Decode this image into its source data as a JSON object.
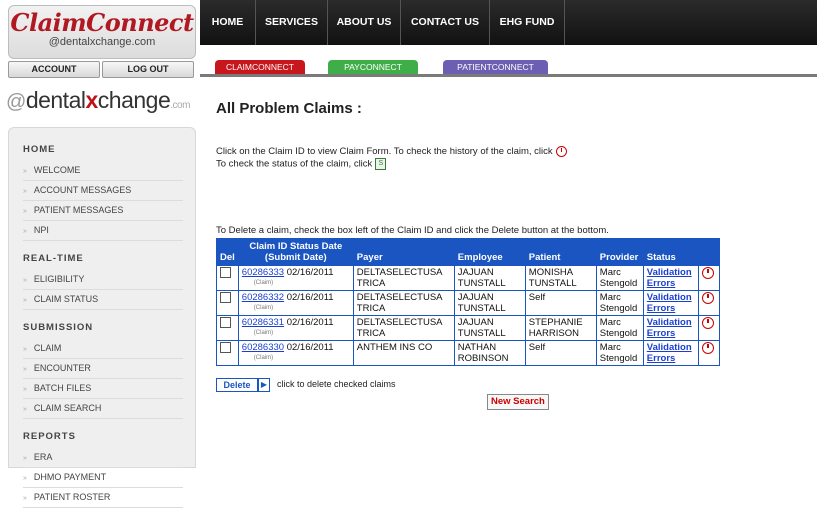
{
  "logo": {
    "title": "ClaimConnect",
    "sub": "@dentalxchange.com"
  },
  "account_bar": {
    "account_label": "ACCOUNT",
    "logout_label": "LOG OUT"
  },
  "brand": {
    "at": "@",
    "dental": "dental",
    "x": "x",
    "change": "change",
    "com": ".com"
  },
  "sidebar": {
    "sections": [
      {
        "title": "HOME",
        "items": [
          "WELCOME",
          "ACCOUNT MESSAGES",
          "PATIENT MESSAGES",
          "NPI"
        ]
      },
      {
        "title": "REAL-TIME",
        "items": [
          "ELIGIBILITY",
          "CLAIM STATUS"
        ]
      },
      {
        "title": "SUBMISSION",
        "items": [
          "CLAIM",
          "ENCOUNTER",
          "BATCH FILES",
          "CLAIM SEARCH"
        ]
      },
      {
        "title": "REPORTS",
        "items": [
          "ERA",
          "DHMO PAYMENT",
          "PATIENT ROSTER"
        ]
      }
    ]
  },
  "topnav": {
    "tabs": [
      "HOME",
      "SERVICES",
      "ABOUT US",
      "CONTACT US",
      "EHG FUND"
    ]
  },
  "subnav": {
    "tabs": [
      "CLAIMCONNECT",
      "PAYCONNECT",
      "PATIENTCONNECT"
    ]
  },
  "page": {
    "title": "All Problem Claims :",
    "instr1": "Click on the Claim ID to view Claim Form. To check the history of the claim, click",
    "instr2": "To check the status of the claim, click",
    "instr3": "To Delete a claim, check the box left of the Claim ID and click the Delete button at the bottom."
  },
  "table": {
    "headers": {
      "del": "Del",
      "claim": "Claim ID",
      "status_date": "Status Date (Submit Date)",
      "payer": "Payer",
      "employee": "Employee",
      "patient": "Patient",
      "provider": "Provider",
      "status": "Status"
    },
    "rows": [
      {
        "claim_id": "60286333",
        "sub": "(Claim)",
        "date": "02/16/2011",
        "payer": "DELTASELECTUSA TRICA",
        "employee": "JAJUAN TUNSTALL",
        "patient": "MONISHA TUNSTALL",
        "provider": "Marc Stengold",
        "status": "Validation Errors"
      },
      {
        "claim_id": "60286332",
        "sub": "(Claim)",
        "date": "02/16/2011",
        "payer": "DELTASELECTUSA TRICA",
        "employee": "JAJUAN TUNSTALL",
        "patient": "Self",
        "provider": "Marc Stengold",
        "status": "Validation Errors"
      },
      {
        "claim_id": "60286331",
        "sub": "(Claim)",
        "date": "02/16/2011",
        "payer": "DELTASELECTUSA TRICA",
        "employee": "JAJUAN TUNSTALL",
        "patient": "STEPHANIE HARRISON",
        "provider": "Marc Stengold",
        "status": "Validation Errors"
      },
      {
        "claim_id": "60286330",
        "sub": "(Claim)",
        "date": "02/16/2011",
        "payer": "ANTHEM INS CO",
        "employee": "NATHAN ROBINSON",
        "patient": "Self",
        "provider": "Marc Stengold",
        "status": "Validation Errors"
      }
    ]
  },
  "footer": {
    "delete_label": "Delete",
    "delete_text": "click to delete checked claims",
    "new_search_label": "New Search"
  },
  "colors": {
    "topbar": "#1a1a1a",
    "table_header": "#1a55c2",
    "logo_red": "#b01922",
    "claimconnect_tab": "#c8161d",
    "payconnect_tab": "#3fae49",
    "patientconnect_tab": "#6c5fb3"
  }
}
